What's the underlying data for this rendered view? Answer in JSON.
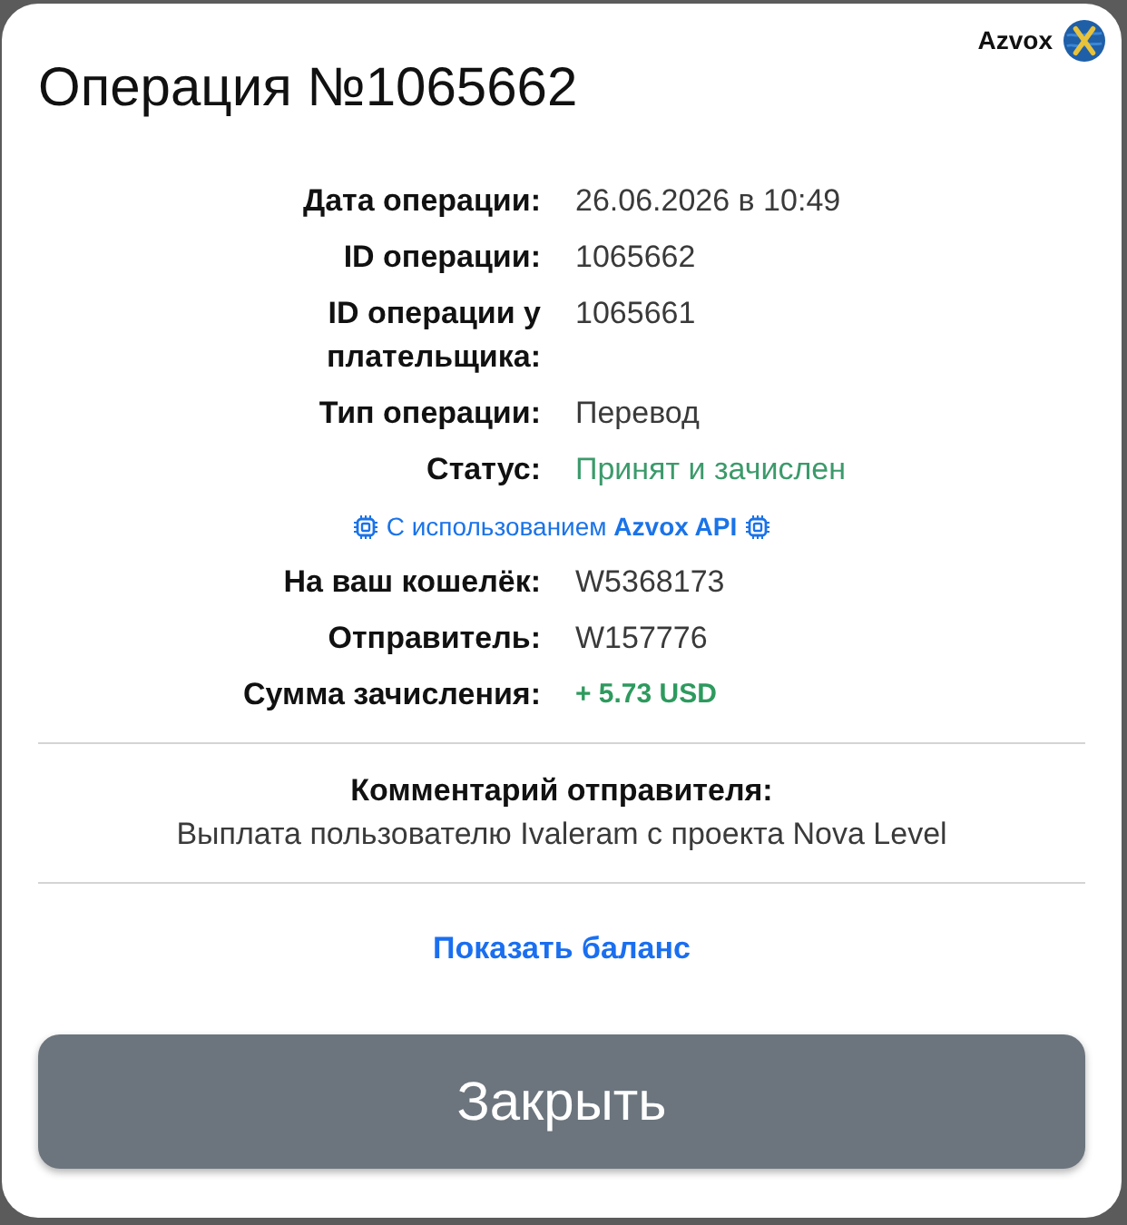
{
  "dialog": {
    "title": "Операция №1065662",
    "brand": "Azvox"
  },
  "details": [
    {
      "kind": "field",
      "label": "Дата операции:",
      "value": "26.06.2026 в 10:49"
    },
    {
      "kind": "field",
      "label": "ID операции:",
      "value": "1065662"
    },
    {
      "kind": "field",
      "label": "ID операции у плательщика:",
      "value": "1065661"
    },
    {
      "kind": "field",
      "label": "Тип операции:",
      "value": "Перевод"
    },
    {
      "kind": "status",
      "label": "Статус:",
      "value": "Принят и зачислен"
    },
    {
      "kind": "note",
      "text": "С использованием **Azvox API**"
    },
    {
      "kind": "field",
      "label": "На ваш кошелёк:",
      "value": "W5368173"
    },
    {
      "kind": "field",
      "label": "Отправитель:",
      "value": "W157776"
    },
    {
      "kind": "amount",
      "label": "Сумма зачисления:",
      "value": "+ 5.73 USD"
    }
  ],
  "comment": {
    "heading": "Комментарий отправителя:",
    "text": "Выплата пользователю Ivaleram с проекта Nova Level"
  },
  "balance_link": "Показать баланс",
  "close_button": "Закрыть"
}
